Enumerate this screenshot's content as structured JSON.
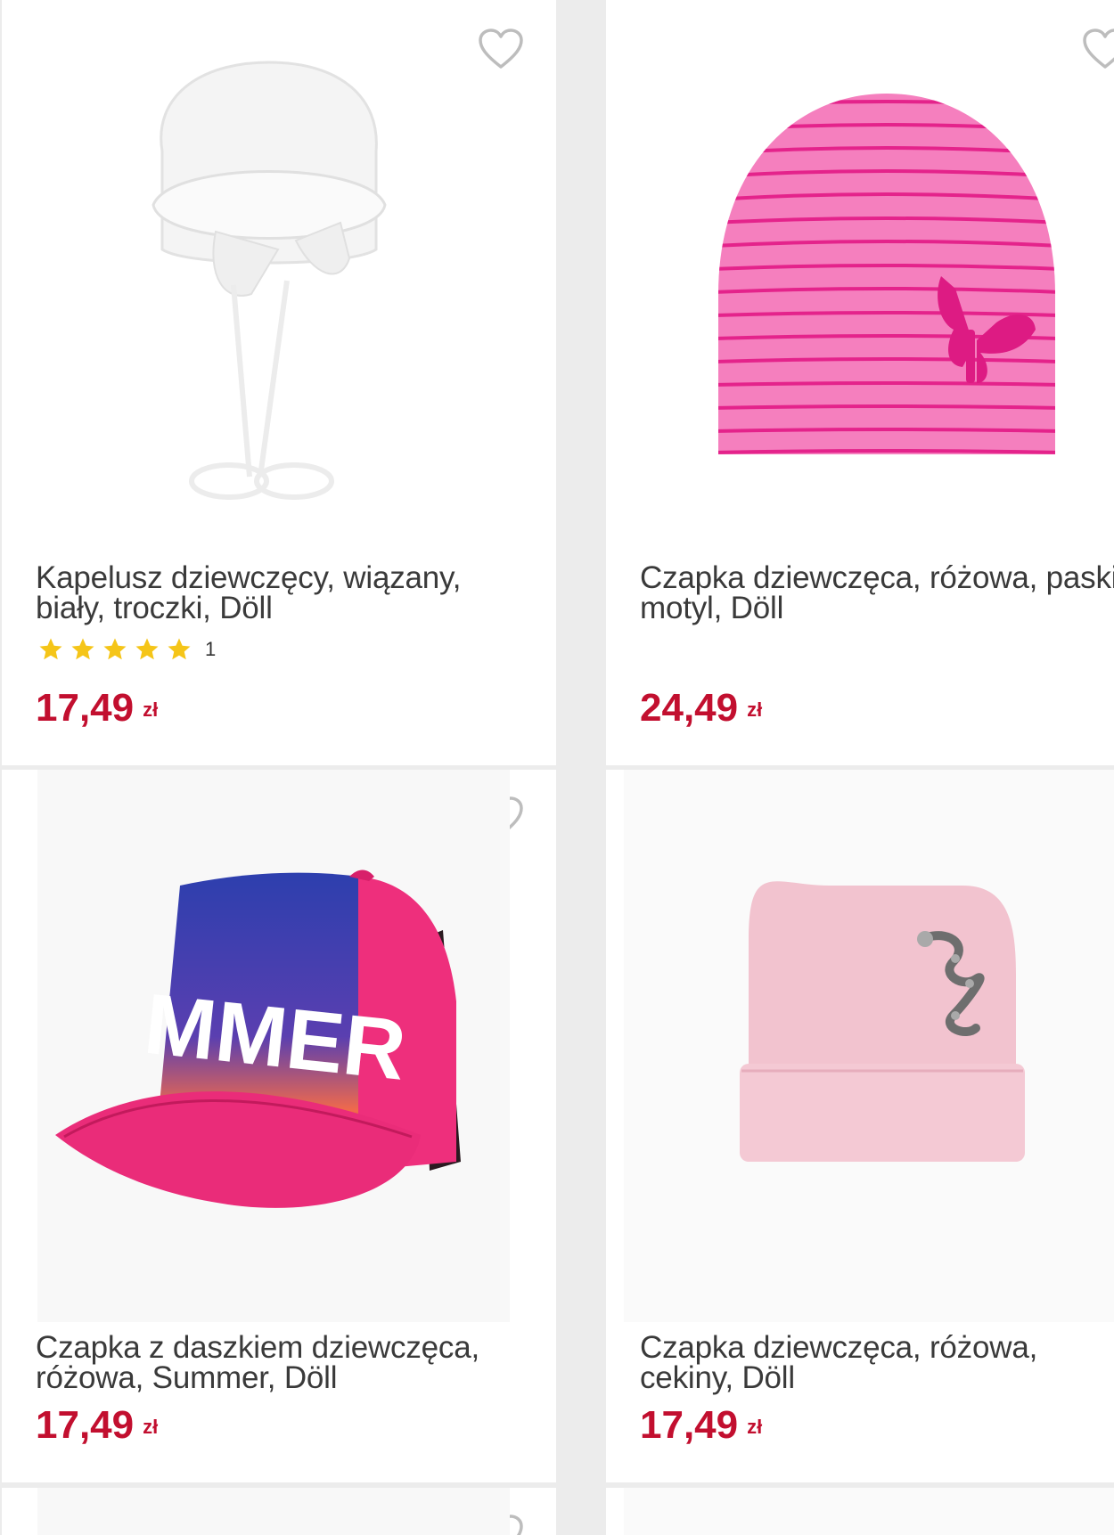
{
  "products": [
    {
      "title": "Kapelusz dziewczęcy, wiązany,\nbiały, troczki, Döll",
      "rating_count": "1",
      "rating_stars": 5,
      "price": "17,49",
      "currency": "zł"
    },
    {
      "title": "Czapka dziewczęca, różowa, paski,\nmotyl, Döll",
      "price": "24,49",
      "currency": "zł"
    },
    {
      "title": "Czapka z daszkiem dziewczęca,\nróżowa, Summer, Döll",
      "price": "17,49",
      "currency": "zł"
    },
    {
      "title": "Czapka dziewczęca, różowa,\ncekiny, Döll",
      "price": "17,49",
      "currency": "zł"
    }
  ],
  "cap_print_text": "MMER",
  "colors": {
    "price": "#c20f2f",
    "star": "#f5c518",
    "heart": "#bdbdbd",
    "background": "#ececec"
  },
  "icons": [
    "heart-outline-icon",
    "star-icon"
  ]
}
